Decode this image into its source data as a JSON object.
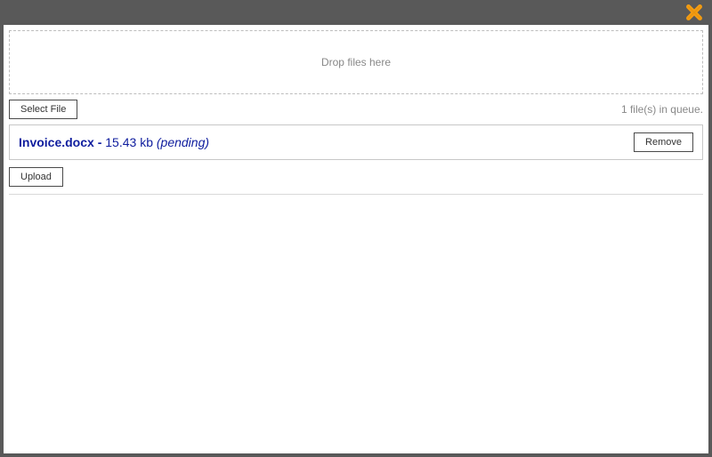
{
  "dropzone": {
    "text": "Drop files here"
  },
  "buttons": {
    "select": "Select File",
    "upload": "Upload",
    "remove": "Remove"
  },
  "queue": {
    "status_text": "1 file(s) in queue."
  },
  "file": {
    "name": "Invoice.docx",
    "sep": " - ",
    "size": "15.43 kb",
    "status": " (pending)"
  }
}
